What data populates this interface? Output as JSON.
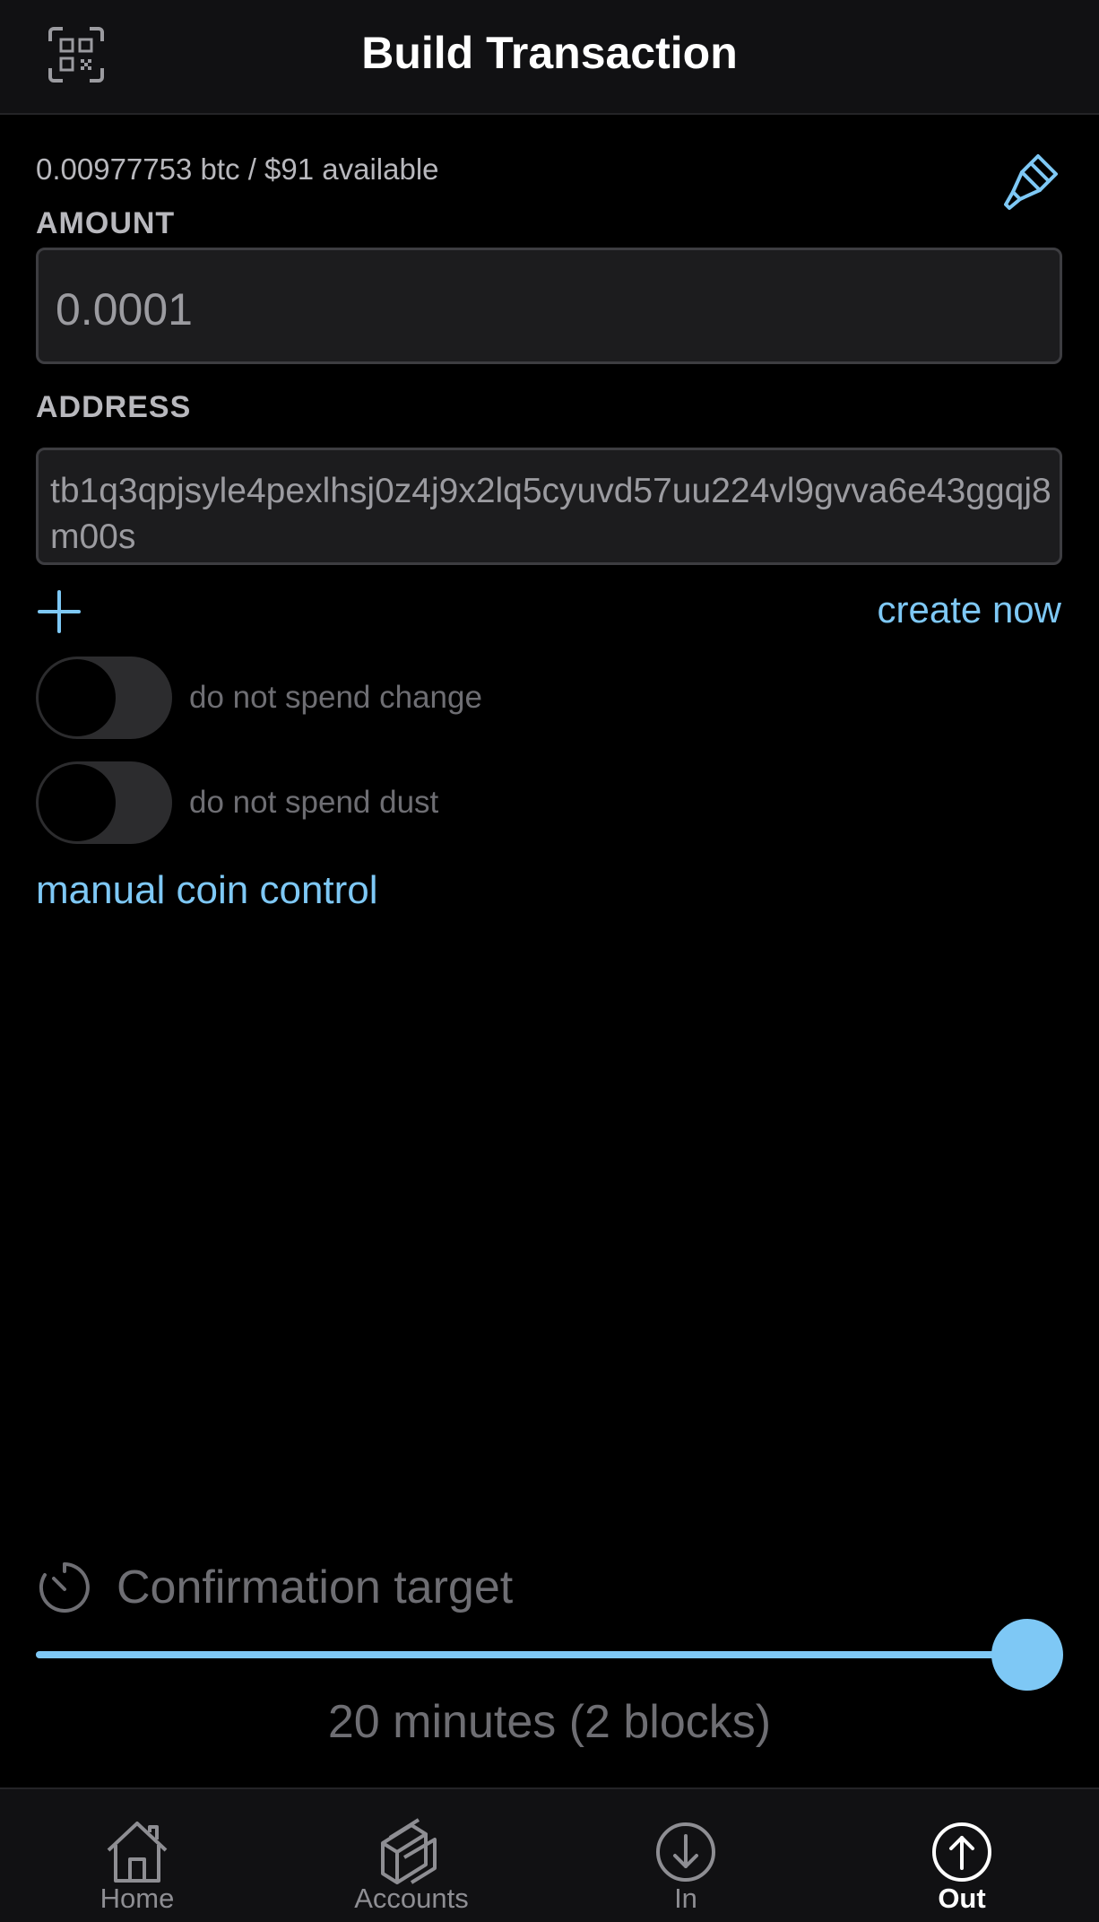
{
  "header": {
    "title": "Build Transaction",
    "scan_icon": "qr-scan-icon"
  },
  "balance": {
    "available_text": "0.00977753 btc / $91 available",
    "paint_icon": "paintbrush-icon"
  },
  "amount": {
    "label": "AMOUNT",
    "value": "0.0001"
  },
  "address": {
    "label": "ADDRESS",
    "value": "tb1q3qpjsyle4pexlhsj0z4j9x2lq5cyuvd57uu224vl9gvva6e43ggqj8m00s"
  },
  "actions": {
    "add_icon": "plus-icon",
    "create_now_label": "create now"
  },
  "toggles": [
    {
      "label": "do not spend change",
      "on": false
    },
    {
      "label": "do not spend dust",
      "on": false
    }
  ],
  "manual_coin_control_label": "manual coin control",
  "confirmation": {
    "icon": "timer-icon",
    "label": "Confirmation target",
    "value_text": "20 minutes (2 blocks)",
    "slider_fraction": 1.0
  },
  "tabs": [
    {
      "label": "Home",
      "icon": "home-icon",
      "active": false
    },
    {
      "label": "Accounts",
      "icon": "accounts-icon",
      "active": false
    },
    {
      "label": "In",
      "icon": "arrow-down-circle-icon",
      "active": false
    },
    {
      "label": "Out",
      "icon": "arrow-up-circle-icon",
      "active": true
    }
  ],
  "colors": {
    "accent": "#7ec8f5",
    "background": "#000000",
    "surface": "#1c1c1e",
    "muted_text": "#6e6e73"
  }
}
